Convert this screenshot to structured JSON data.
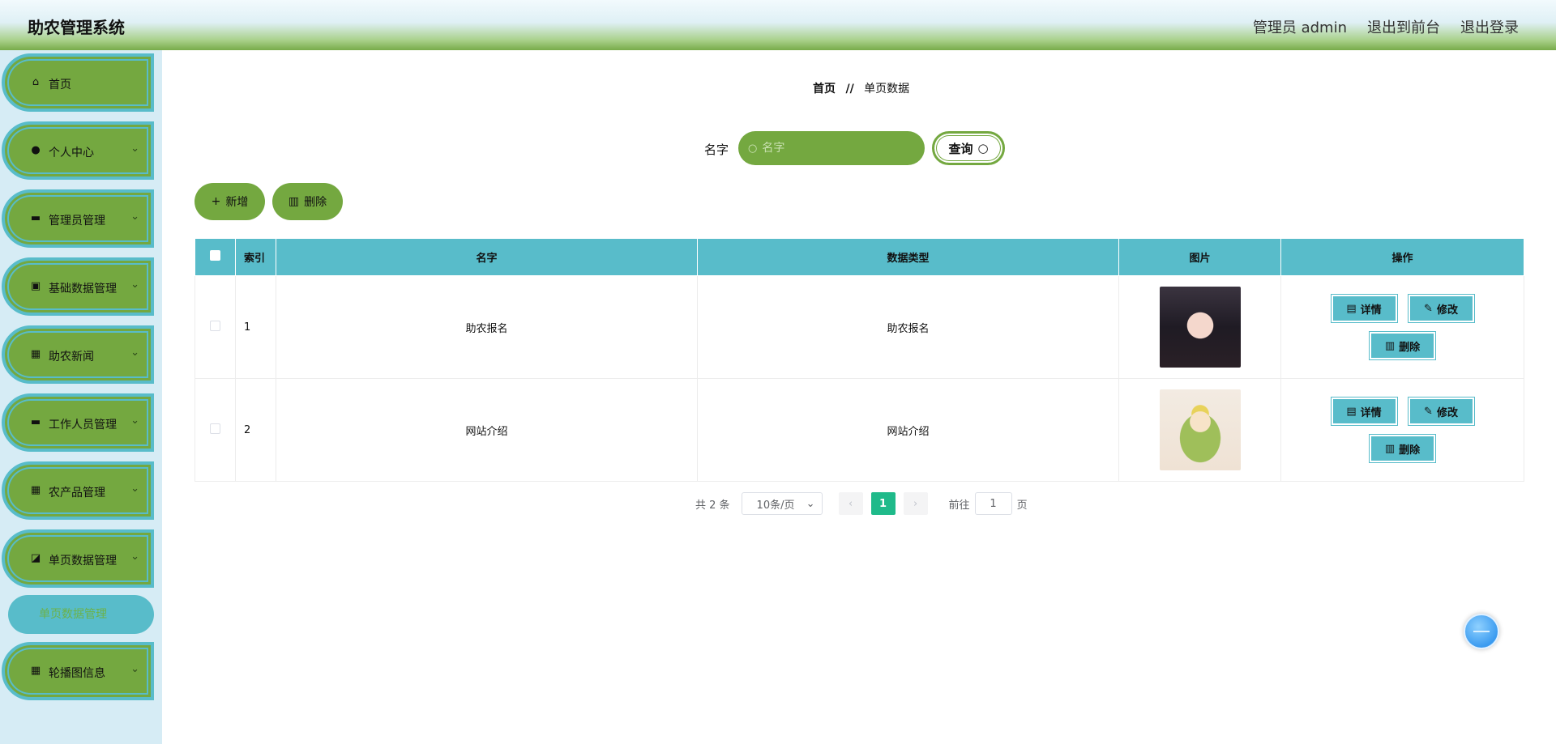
{
  "header": {
    "title": "助农管理系统",
    "user": "管理员 admin",
    "front_link": "退出到前台",
    "logout_link": "退出登录"
  },
  "sidebar": {
    "items": [
      {
        "label": "首页",
        "icon": "home-icon"
      },
      {
        "label": "个人中心",
        "icon": "user-icon"
      },
      {
        "label": "管理员管理",
        "icon": "monitor-icon"
      },
      {
        "label": "基础数据管理",
        "icon": "clipboard-icon"
      },
      {
        "label": "助农新闻",
        "icon": "grid-icon"
      },
      {
        "label": "工作人员管理",
        "icon": "device-icon"
      },
      {
        "label": "农产品管理",
        "icon": "grid-icon"
      },
      {
        "label": "单页数据管理",
        "icon": "chart-icon"
      },
      {
        "label": "轮播图信息",
        "icon": "grid-icon"
      }
    ],
    "submenu_active": "单页数据管理"
  },
  "breadcrumb": {
    "home": "首页",
    "separator": "//",
    "current": "单页数据"
  },
  "search": {
    "label": "名字",
    "placeholder": "名字",
    "button": "查询"
  },
  "toolbar": {
    "add": "新增",
    "delete": "删除"
  },
  "table": {
    "headers": [
      "索引",
      "名字",
      "数据类型",
      "图片",
      "操作"
    ],
    "rows": [
      {
        "index": "1",
        "name": "助农报名",
        "type": "助农报名"
      },
      {
        "index": "2",
        "name": "网站介绍",
        "type": "网站介绍"
      }
    ],
    "ops": {
      "detail": "详情",
      "edit": "修改",
      "delete": "删除"
    }
  },
  "pagination": {
    "total": "共 2 条",
    "page_size": "10条/页",
    "current_page": "1",
    "goto_label": "前往",
    "goto_value": "1",
    "goto_suffix": "页"
  },
  "colors": {
    "green": "#74a840",
    "teal": "#58bcca",
    "page_active": "#1fba8a"
  }
}
